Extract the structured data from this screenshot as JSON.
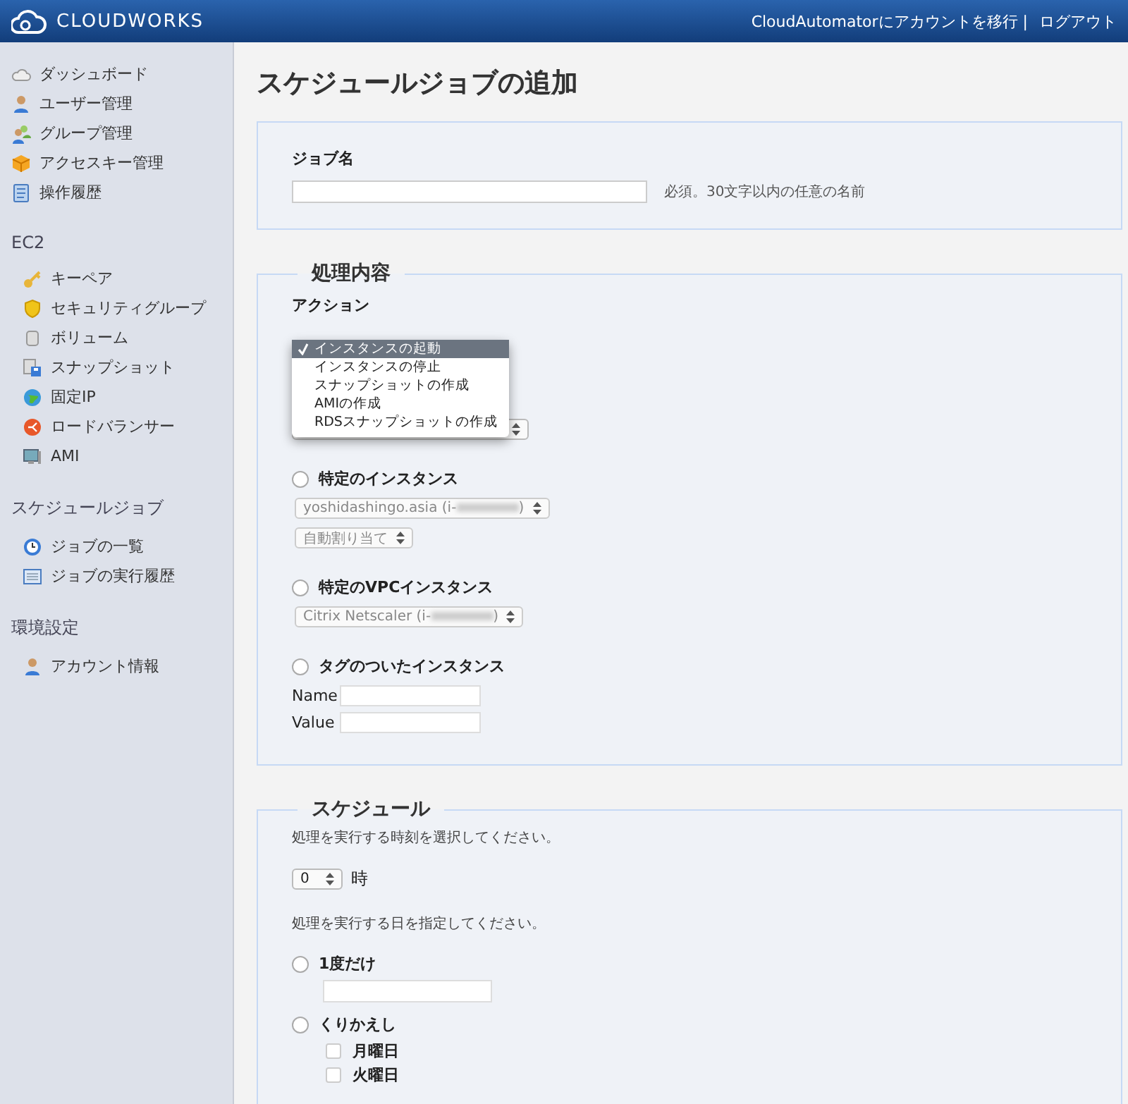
{
  "header": {
    "brand": "CLOUDWORKS",
    "links": [
      {
        "label": "CloudAutomatorにアカウントを移行 |"
      },
      {
        "label": "ログアウト"
      }
    ]
  },
  "sidebar": {
    "sections": [
      {
        "items": [
          {
            "label": "ダッシュボード"
          },
          {
            "label": "ユーザー管理"
          },
          {
            "label": "グループ管理"
          },
          {
            "label": "アクセスキー管理"
          },
          {
            "label": "操作履歴"
          }
        ]
      },
      {
        "title": "EC2",
        "items": [
          {
            "label": "キーペア"
          },
          {
            "label": "セキュリティグループ"
          },
          {
            "label": "ボリューム"
          },
          {
            "label": "スナップショット"
          },
          {
            "label": "固定IP"
          },
          {
            "label": "ロードバランサー"
          },
          {
            "label": "AMI"
          }
        ]
      },
      {
        "title": "スケジュールジョブ",
        "items": [
          {
            "label": "ジョブの一覧"
          },
          {
            "label": "ジョブの実行履歴"
          }
        ]
      },
      {
        "title": "環境設定",
        "items": [
          {
            "label": "アカウント情報"
          }
        ]
      }
    ]
  },
  "page_title": "スケジュールジョブの追加",
  "job_name": {
    "label": "ジョブ名",
    "hint": "必須。30文字以内の任意の名前"
  },
  "process": {
    "legend": "処理内容",
    "action_label": "アクション",
    "action_menu": [
      {
        "label": "インスタンスの起動",
        "selected": true
      },
      {
        "label": "インスタンスの停止",
        "selected": false
      },
      {
        "label": "スナップショットの作成",
        "selected": false
      },
      {
        "label": "AMIの作成",
        "selected": false
      },
      {
        "label": "RDSスナップショットの作成",
        "selected": false
      }
    ],
    "targets": [
      {
        "label": "特定のインスタンス",
        "selected": false,
        "selects": [
          {
            "value": "yoshidashingo.asia (i-",
            "suffix": ")"
          },
          {
            "value": "自動割り当て"
          }
        ]
      },
      {
        "label": "特定のVPCインスタンス",
        "selected": false,
        "selects": [
          {
            "value": "Citrix Netscaler (i-",
            "suffix": ")"
          }
        ]
      },
      {
        "label": "タグのついたインスタンス",
        "selected": false,
        "fields": [
          {
            "label": "Name"
          },
          {
            "label": "Value"
          }
        ]
      }
    ]
  },
  "schedule": {
    "legend": "スケジュール",
    "time_prompt": "処理を実行する時刻を選択してください。",
    "hour": "0",
    "hour_unit": "時",
    "day_prompt": "処理を実行する日を指定してください。",
    "modes": [
      {
        "kind": "date",
        "label": "1度だけ",
        "selected": false
      },
      {
        "kind": "repeat",
        "label": "くりかえし",
        "selected": false,
        "days": [
          {
            "label": "月曜日",
            "checked": false
          },
          {
            "label": "火曜日",
            "checked": false
          }
        ]
      }
    ]
  }
}
